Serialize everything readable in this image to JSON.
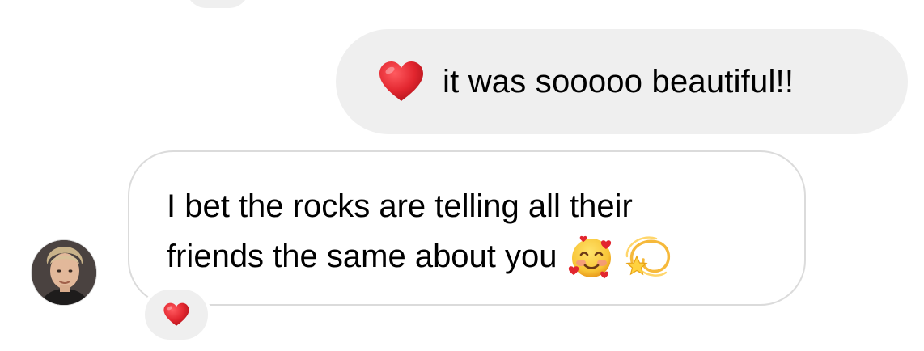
{
  "thread": {
    "outgoing_message": {
      "emoji_icon": "red-heart-icon",
      "text": "it was sooooo beautiful!!"
    },
    "incoming_message": {
      "line1": "I bet the rocks are telling all their",
      "line2": "friends the same about you",
      "emojis": [
        "smiling-face-with-hearts-icon",
        "dizzy-star-icon"
      ],
      "reaction_icon": "red-heart-icon"
    },
    "avatar_icon": "contact-avatar"
  },
  "colors": {
    "bubble_gray": "#efefef",
    "border_gray": "#dbdbdb",
    "heart_red": "#e2262f"
  }
}
